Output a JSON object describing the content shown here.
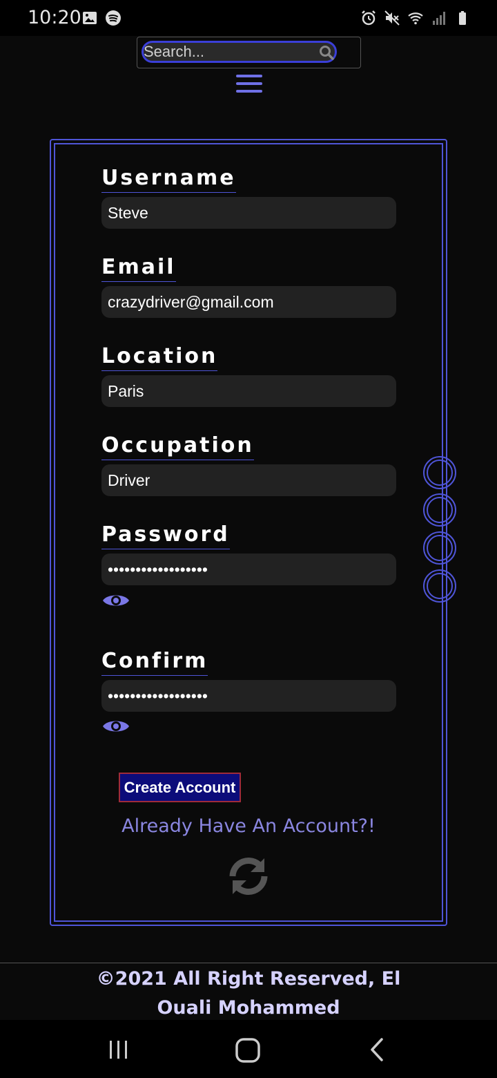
{
  "status_bar": {
    "time": "10:20",
    "left_icons": [
      "image-icon",
      "spotify-icon"
    ],
    "right_icons": [
      "alarm-icon",
      "mute-icon",
      "wifi-icon",
      "signal-icon",
      "battery-icon"
    ]
  },
  "search": {
    "placeholder": "Search..."
  },
  "form": {
    "fields": [
      {
        "label": "Username",
        "value": "Steve"
      },
      {
        "label": "Email",
        "value": "crazydriver@gmail.com"
      },
      {
        "label": "Location",
        "value": "Paris"
      },
      {
        "label": "Occupation",
        "value": "Driver"
      },
      {
        "label": "Password",
        "value": "••••••••••••••••••"
      },
      {
        "label": "Confirm",
        "value": "••••••••••••••••••"
      }
    ],
    "create_button": "Create Account",
    "login_link": "Already Have An Account?!"
  },
  "footer": {
    "text": "©2021 All Right Reserved, El Ouali Mohammed"
  },
  "colors": {
    "accent": "#4f55d8",
    "link": "#8a86e0",
    "button_bg": "#0c0c7a",
    "footer_text": "#d6d2ff"
  }
}
